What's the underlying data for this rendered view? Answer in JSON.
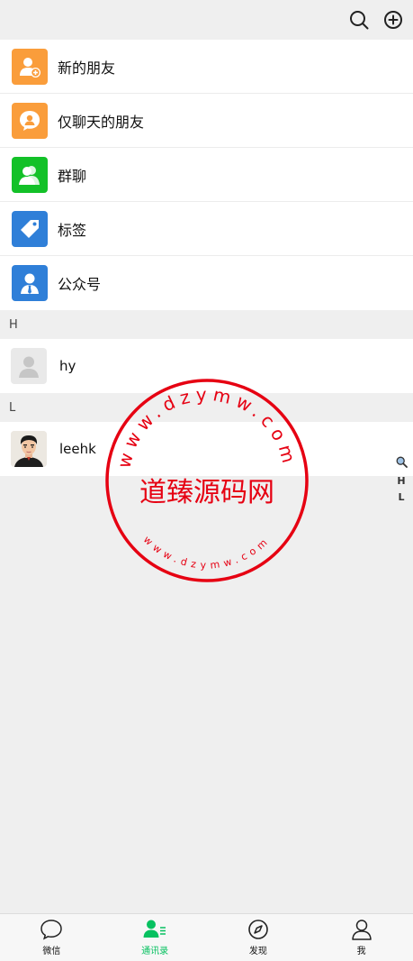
{
  "topbar": {
    "icons": [
      "search-icon",
      "add-circle-icon"
    ]
  },
  "features": [
    {
      "label": "新的朋友",
      "color": "#fa9d3b",
      "icon": "add-friend-icon"
    },
    {
      "label": "仅聊天的朋友",
      "color": "#fa9d3b",
      "icon": "chat-only-icon"
    },
    {
      "label": "群聊",
      "color": "#13c128",
      "icon": "group-chat-icon"
    },
    {
      "label": "标签",
      "color": "#2f7fd8",
      "icon": "tag-icon"
    },
    {
      "label": "公众号",
      "color": "#2f7fd8",
      "icon": "official-account-icon"
    }
  ],
  "sections": [
    {
      "letter": "H",
      "contacts": [
        {
          "name": "hy",
          "avatar": "default-avatar"
        }
      ]
    },
    {
      "letter": "L",
      "contacts": [
        {
          "name": "leehk",
          "avatar": "cartoon-avatar"
        }
      ]
    }
  ],
  "index_bar": [
    "H",
    "L"
  ],
  "watermark": {
    "center_text": "道臻源码网",
    "ring_text": "www.dzymw.com",
    "color": "#e60012"
  },
  "tabs": [
    {
      "label": "微信",
      "icon": "chat-bubble-icon",
      "active": false
    },
    {
      "label": "通讯录",
      "icon": "contacts-icon",
      "active": true
    },
    {
      "label": "发现",
      "icon": "compass-icon",
      "active": false
    },
    {
      "label": "我",
      "icon": "person-icon",
      "active": false
    }
  ],
  "colors": {
    "accent": "#07c160",
    "background": "#efefef"
  }
}
